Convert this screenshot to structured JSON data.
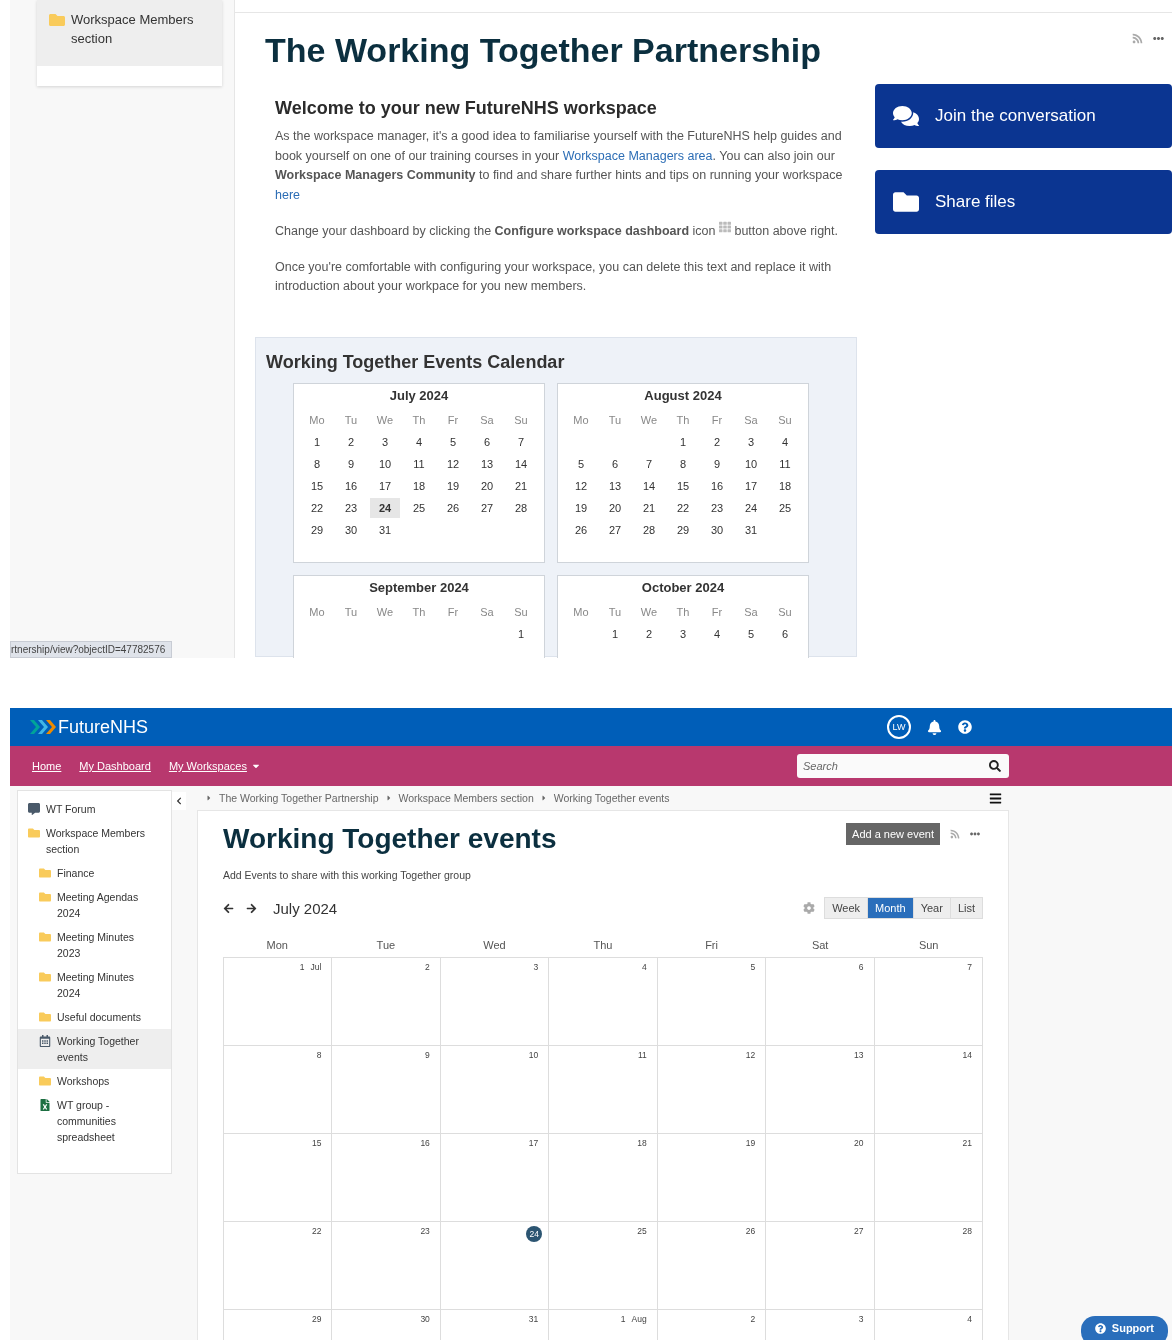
{
  "top": {
    "sidebar_item": {
      "label": "Workspace Members section",
      "selected": true
    },
    "status_url": "rtnership/view?objectID=47782576",
    "title": "The Working Together Partnership",
    "welcome": {
      "heading": "Welcome to your new FutureNHS workspace",
      "paragraphs": [
        [
          {
            "kind": "text",
            "text": "As the workspace manager, it's a good idea to familiarise yourself with the FutureNHS help guides and book yourself on one of our training courses in your "
          },
          {
            "kind": "link",
            "text": "Workspace Managers area"
          },
          {
            "kind": "text",
            "text": ". You can also join our **Workspace Managers Community** to find and share further hints and tips on running your workspace "
          },
          {
            "kind": "link",
            "text": "here"
          }
        ],
        [
          {
            "kind": "text",
            "text": "Change your dashboard by clicking the **Configure workspace dashboard** icon "
          },
          {
            "kind": "icon"
          },
          {
            "kind": "text",
            "text": " button above right."
          }
        ],
        [
          {
            "kind": "text",
            "text": "Once you're comfortable with configuring your workspace, you can delete this text and replace it with introduction about your workpace for you new members."
          }
        ]
      ]
    },
    "actions": [
      {
        "label": "Join the conversation",
        "kind": "chat"
      },
      {
        "label": "Share files",
        "kind": "folder"
      }
    ],
    "calendar": {
      "title": "Working Together Events Calendar",
      "months": [
        {
          "name": "July 2024",
          "weekdays": [
            "Mo",
            "Tu",
            "We",
            "Th",
            "Fr",
            "Sa",
            "Su"
          ],
          "weeks": [
            [
              {
                "kind": "day",
                "d": "1",
                "today": false
              },
              {
                "kind": "day",
                "d": "2",
                "today": false
              },
              {
                "kind": "day",
                "d": "3",
                "today": false
              },
              {
                "kind": "day",
                "d": "4",
                "today": false
              },
              {
                "kind": "day",
                "d": "5",
                "today": false
              },
              {
                "kind": "day",
                "d": "6",
                "today": false
              },
              {
                "kind": "day",
                "d": "7",
                "today": false
              }
            ],
            [
              {
                "kind": "day",
                "d": "8",
                "today": false
              },
              {
                "kind": "day",
                "d": "9",
                "today": false
              },
              {
                "kind": "day",
                "d": "10",
                "today": false
              },
              {
                "kind": "day",
                "d": "11",
                "today": false
              },
              {
                "kind": "day",
                "d": "12",
                "today": false
              },
              {
                "kind": "day",
                "d": "13",
                "today": false
              },
              {
                "kind": "day",
                "d": "14",
                "today": false
              }
            ],
            [
              {
                "kind": "day",
                "d": "15",
                "today": false
              },
              {
                "kind": "day",
                "d": "16",
                "today": false
              },
              {
                "kind": "day",
                "d": "17",
                "today": false
              },
              {
                "kind": "day",
                "d": "18",
                "today": false
              },
              {
                "kind": "day",
                "d": "19",
                "today": false
              },
              {
                "kind": "day",
                "d": "20",
                "today": false
              },
              {
                "kind": "day",
                "d": "21",
                "today": false
              }
            ],
            [
              {
                "kind": "day",
                "d": "22",
                "today": false
              },
              {
                "kind": "day",
                "d": "23",
                "today": false
              },
              {
                "kind": "day",
                "d": "24",
                "today": true
              },
              {
                "kind": "day",
                "d": "25",
                "today": false
              },
              {
                "kind": "day",
                "d": "26",
                "today": false
              },
              {
                "kind": "day",
                "d": "27",
                "today": false
              },
              {
                "kind": "day",
                "d": "28",
                "today": false
              }
            ],
            [
              {
                "kind": "day",
                "d": "29",
                "today": false
              },
              {
                "kind": "day",
                "d": "30",
                "today": false
              },
              {
                "kind": "day",
                "d": "31",
                "today": false
              },
              {
                "kind": "blank"
              },
              {
                "kind": "blank"
              },
              {
                "kind": "blank"
              },
              {
                "kind": "blank"
              }
            ]
          ]
        },
        {
          "name": "August 2024",
          "weekdays": [
            "Mo",
            "Tu",
            "We",
            "Th",
            "Fr",
            "Sa",
            "Su"
          ],
          "weeks": [
            [
              {
                "kind": "blank"
              },
              {
                "kind": "blank"
              },
              {
                "kind": "blank"
              },
              {
                "kind": "day",
                "d": "1",
                "today": false
              },
              {
                "kind": "day",
                "d": "2",
                "today": false
              },
              {
                "kind": "day",
                "d": "3",
                "today": false
              },
              {
                "kind": "day",
                "d": "4",
                "today": false
              }
            ],
            [
              {
                "kind": "day",
                "d": "5",
                "today": false
              },
              {
                "kind": "day",
                "d": "6",
                "today": false
              },
              {
                "kind": "day",
                "d": "7",
                "today": false
              },
              {
                "kind": "day",
                "d": "8",
                "today": false
              },
              {
                "kind": "day",
                "d": "9",
                "today": false
              },
              {
                "kind": "day",
                "d": "10",
                "today": false
              },
              {
                "kind": "day",
                "d": "11",
                "today": false
              }
            ],
            [
              {
                "kind": "day",
                "d": "12",
                "today": false
              },
              {
                "kind": "day",
                "d": "13",
                "today": false
              },
              {
                "kind": "day",
                "d": "14",
                "today": false
              },
              {
                "kind": "day",
                "d": "15",
                "today": false
              },
              {
                "kind": "day",
                "d": "16",
                "today": false
              },
              {
                "kind": "day",
                "d": "17",
                "today": false
              },
              {
                "kind": "day",
                "d": "18",
                "today": false
              }
            ],
            [
              {
                "kind": "day",
                "d": "19",
                "today": false
              },
              {
                "kind": "day",
                "d": "20",
                "today": false
              },
              {
                "kind": "day",
                "d": "21",
                "today": false
              },
              {
                "kind": "day",
                "d": "22",
                "today": false
              },
              {
                "kind": "day",
                "d": "23",
                "today": false
              },
              {
                "kind": "day",
                "d": "24",
                "today": false
              },
              {
                "kind": "day",
                "d": "25",
                "today": false
              }
            ],
            [
              {
                "kind": "day",
                "d": "26",
                "today": false
              },
              {
                "kind": "day",
                "d": "27",
                "today": false
              },
              {
                "kind": "day",
                "d": "28",
                "today": false
              },
              {
                "kind": "day",
                "d": "29",
                "today": false
              },
              {
                "kind": "day",
                "d": "30",
                "today": false
              },
              {
                "kind": "day",
                "d": "31",
                "today": false
              },
              {
                "kind": "blank"
              }
            ]
          ]
        },
        {
          "name": "September 2024",
          "weekdays": [
            "Mo",
            "Tu",
            "We",
            "Th",
            "Fr",
            "Sa",
            "Su"
          ],
          "weeks": [
            [
              {
                "kind": "blank"
              },
              {
                "kind": "blank"
              },
              {
                "kind": "blank"
              },
              {
                "kind": "blank"
              },
              {
                "kind": "blank"
              },
              {
                "kind": "blank"
              },
              {
                "kind": "day",
                "d": "1",
                "today": false
              }
            ]
          ]
        },
        {
          "name": "October 2024",
          "weekdays": [
            "Mo",
            "Tu",
            "We",
            "Th",
            "Fr",
            "Sa",
            "Su"
          ],
          "weeks": [
            [
              {
                "kind": "blank"
              },
              {
                "kind": "day",
                "d": "1",
                "today": false
              },
              {
                "kind": "day",
                "d": "2",
                "today": false
              },
              {
                "kind": "day",
                "d": "3",
                "today": false
              },
              {
                "kind": "day",
                "d": "4",
                "today": false
              },
              {
                "kind": "day",
                "d": "5",
                "today": false
              },
              {
                "kind": "day",
                "d": "6",
                "today": false
              }
            ]
          ]
        }
      ]
    }
  },
  "bottom": {
    "logo": "FutureNHS",
    "avatar": "LW",
    "nav": [
      {
        "label": "Home",
        "dropdown": false
      },
      {
        "label": "My Dashboard",
        "dropdown": false
      },
      {
        "label": "My Workspaces",
        "dropdown": true
      }
    ],
    "search": {
      "placeholder": "Search"
    },
    "sidebar": [
      {
        "label": "WT Forum",
        "kind": "forum",
        "selected": false
      },
      {
        "label": "Workspace Members section",
        "kind": "folder",
        "selected": false,
        "children": [
          {
            "label": "Finance",
            "kind": "folder",
            "selected": false
          },
          {
            "label": "Meeting Agendas 2024",
            "kind": "folder",
            "selected": false
          },
          {
            "label": "Meeting Minutes 2023",
            "kind": "folder",
            "selected": false
          },
          {
            "label": "Meeting Minutes 2024",
            "kind": "folder",
            "selected": false
          },
          {
            "label": "Useful documents",
            "kind": "folder",
            "selected": false
          },
          {
            "label": "Working Together events",
            "kind": "calendar",
            "selected": true
          },
          {
            "label": "Workshops",
            "kind": "folder",
            "selected": false
          },
          {
            "label": "WT group - communities spreadsheet",
            "kind": "spreadsheet",
            "selected": false
          }
        ]
      }
    ],
    "breadcrumbs": [
      "The Working Together Partnership",
      "Workspace Members section",
      "Working Together events"
    ],
    "title": "Working Together events",
    "add_button": "Add a new event",
    "description": "Add Events to share with this working Together group",
    "month": "July 2024",
    "views": [
      {
        "label": "Week",
        "selected": false
      },
      {
        "label": "Month",
        "selected": true
      },
      {
        "label": "Year",
        "selected": false
      },
      {
        "label": "List",
        "selected": false
      }
    ],
    "weekdays": [
      "Mon",
      "Tue",
      "Wed",
      "Thu",
      "Fri",
      "Sat",
      "Sun"
    ],
    "weeks": [
      [
        {
          "d": "1",
          "m": "Jul",
          "today": false
        },
        {
          "d": "2",
          "today": false
        },
        {
          "d": "3",
          "today": false
        },
        {
          "d": "4",
          "today": false
        },
        {
          "d": "5",
          "today": false
        },
        {
          "d": "6",
          "today": false
        },
        {
          "d": "7",
          "today": false
        }
      ],
      [
        {
          "d": "8",
          "today": false
        },
        {
          "d": "9",
          "today": false
        },
        {
          "d": "10",
          "today": false
        },
        {
          "d": "11",
          "today": false
        },
        {
          "d": "12",
          "today": false
        },
        {
          "d": "13",
          "today": false
        },
        {
          "d": "14",
          "today": false
        }
      ],
      [
        {
          "d": "15",
          "today": false
        },
        {
          "d": "16",
          "today": false
        },
        {
          "d": "17",
          "today": false
        },
        {
          "d": "18",
          "today": false
        },
        {
          "d": "19",
          "today": false
        },
        {
          "d": "20",
          "today": false
        },
        {
          "d": "21",
          "today": false
        }
      ],
      [
        {
          "d": "22",
          "today": false
        },
        {
          "d": "23",
          "today": false
        },
        {
          "d": "24",
          "today": true
        },
        {
          "d": "25",
          "today": false
        },
        {
          "d": "26",
          "today": false
        },
        {
          "d": "27",
          "today": false
        },
        {
          "d": "28",
          "today": false
        }
      ],
      [
        {
          "d": "29",
          "today": false
        },
        {
          "d": "30",
          "today": false
        },
        {
          "d": "31",
          "today": false
        },
        {
          "d": "1",
          "m": "Aug",
          "today": false
        },
        {
          "d": "2",
          "today": false
        },
        {
          "d": "3",
          "today": false
        },
        {
          "d": "4",
          "today": false
        }
      ]
    ],
    "support": "Support"
  }
}
